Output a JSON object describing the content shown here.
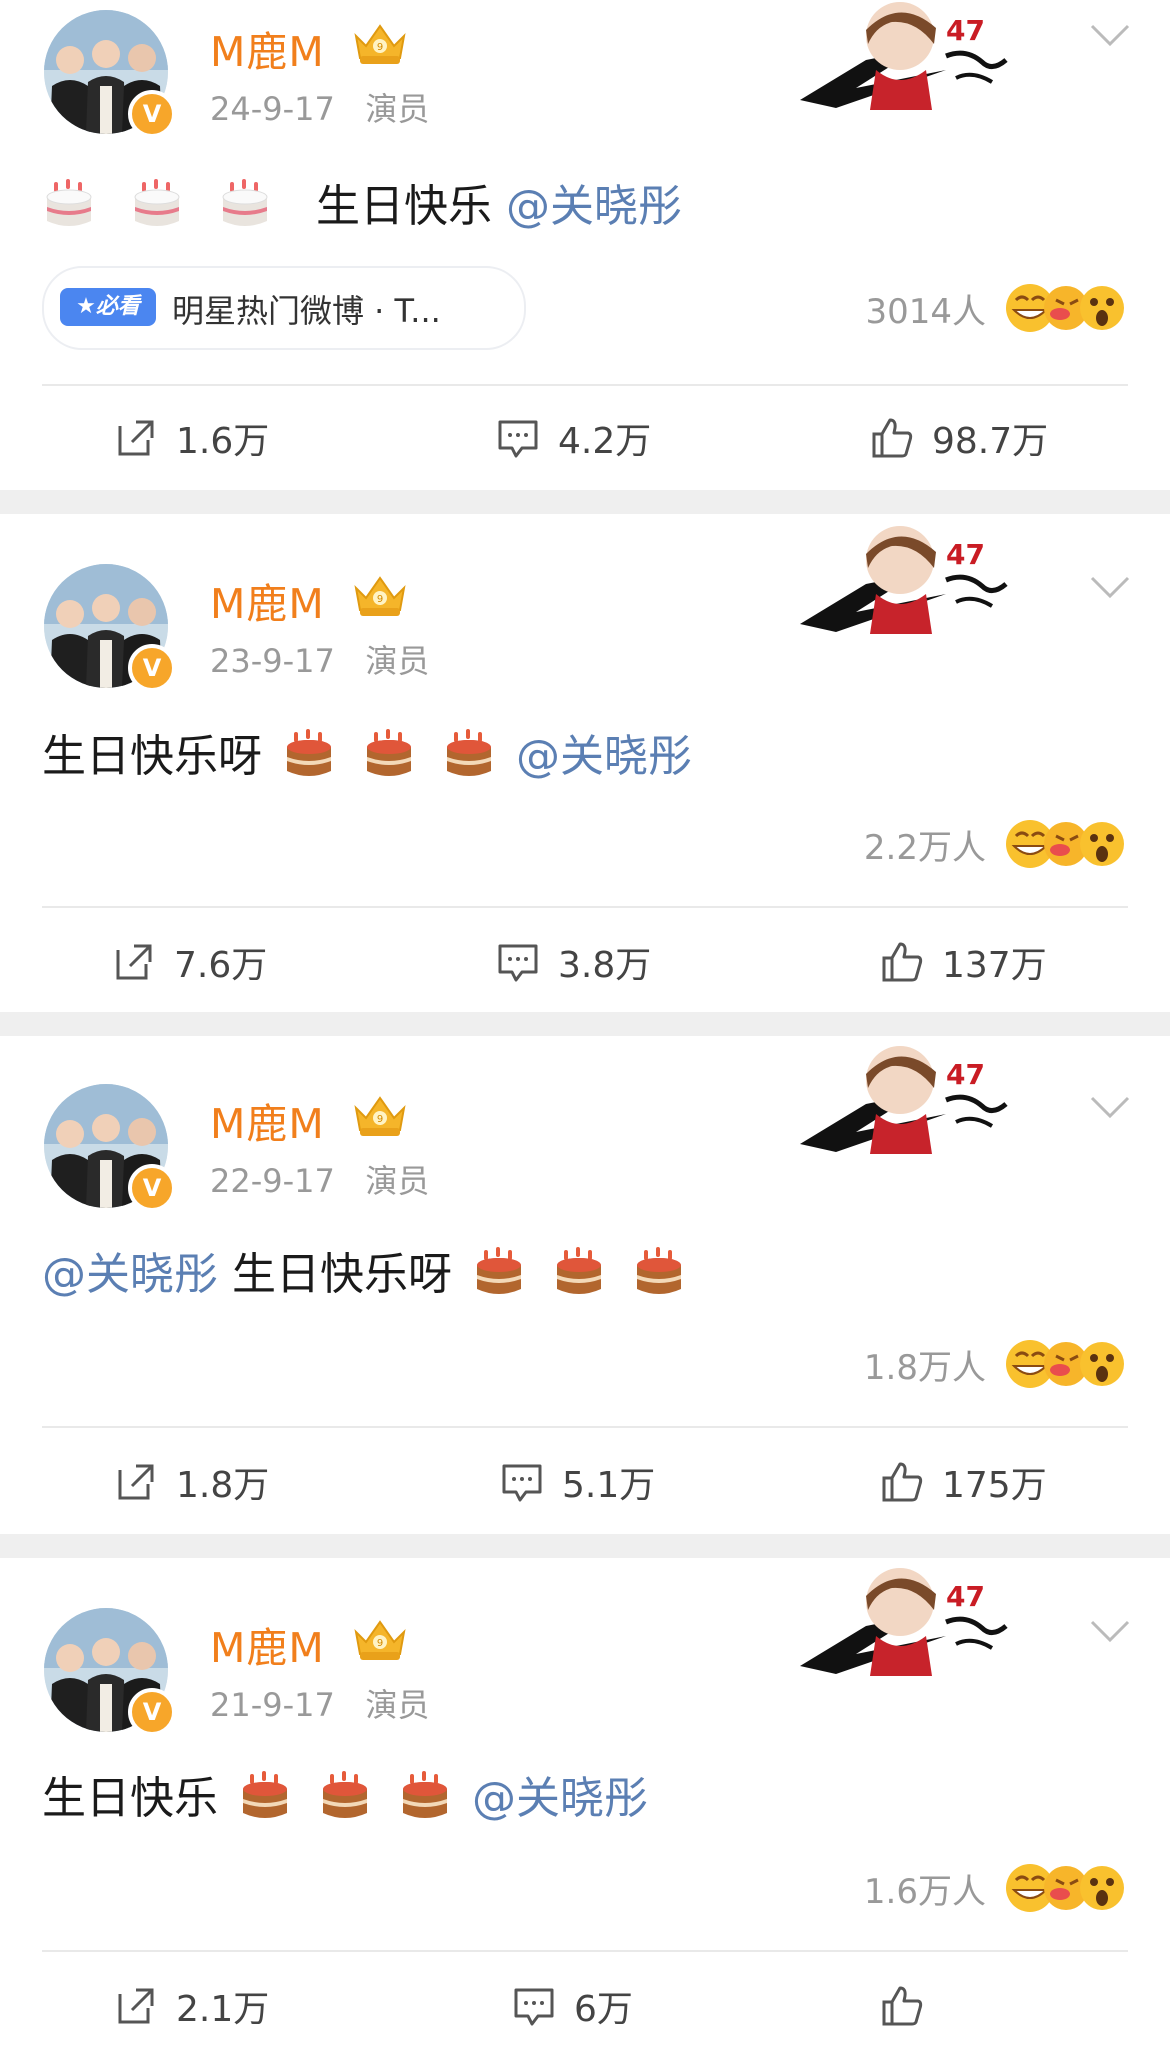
{
  "posts": [
    {
      "author": "M鹿M",
      "date": "24-9-17",
      "role": "演员",
      "content_prefix": "",
      "content_after_cakes": "生日快乐",
      "mention": "@关晓彤",
      "has_tag": true,
      "tag_label": "★必看",
      "tag_text": "明星热门微博 · T...",
      "reaction_count": "3014人",
      "repost": "1.6万",
      "comment": "4.2万",
      "like": "98.7万"
    },
    {
      "author": "M鹿M",
      "date": "23-9-17",
      "role": "演员",
      "content_prefix": "生日快乐呀",
      "mention": "@关晓彤",
      "reaction_count": "2.2万人",
      "repost": "7.6万",
      "comment": "3.8万",
      "like": "137万"
    },
    {
      "author": "M鹿M",
      "date": "22-9-17",
      "role": "演员",
      "mention": "@关晓彤",
      "content_suffix": " 生日快乐呀",
      "reaction_count": "1.8万人",
      "repost": "1.8万",
      "comment": "5.1万",
      "like": "175万"
    },
    {
      "author": "M鹿M",
      "date": "21-9-17",
      "role": "演员",
      "content_prefix": "生日快乐 ",
      "mention": "@关晓彤",
      "reaction_count": "1.6万人",
      "repost": "2.1万",
      "comment": "6万"
    }
  ],
  "icons": {
    "repost": "repost-icon",
    "comment": "comment-icon",
    "like": "like-icon",
    "cake": "birthday-cake-icon",
    "crown": "crown-icon",
    "verified": "verified-badge-icon",
    "more": "chevron-down-icon"
  },
  "colors": {
    "author": "#f17f1c",
    "mention": "#5b7fb3",
    "meta": "#999999",
    "separator": "#efefef"
  }
}
